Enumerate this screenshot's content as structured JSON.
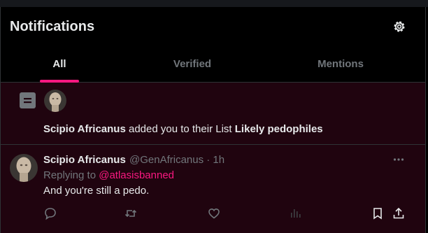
{
  "header": {
    "title": "Notifications",
    "settings_icon": "gear-icon"
  },
  "tabs": [
    {
      "label": "All",
      "active": true
    },
    {
      "label": "Verified",
      "active": false
    },
    {
      "label": "Mentions",
      "active": false
    }
  ],
  "colors": {
    "accent": "#f91880",
    "background": "#000000",
    "highlight_row": "#20040f",
    "muted_text": "#71767b"
  },
  "list_notification": {
    "icon": "list-icon",
    "actor": "Scipio Africanus",
    "text_middle": "added you to their List",
    "list_name": "Likely pedophiles"
  },
  "tweet": {
    "name": "Scipio Africanus",
    "meta": "@GenAfricanus · 1h",
    "replying_prefix": "Replying to",
    "replying_to": "@atlasisbanned",
    "body": "And you're still a pedo.",
    "actions": [
      "reply-icon",
      "retweet-icon",
      "like-icon",
      "views-icon",
      "bookmark-icon",
      "share-icon"
    ]
  }
}
